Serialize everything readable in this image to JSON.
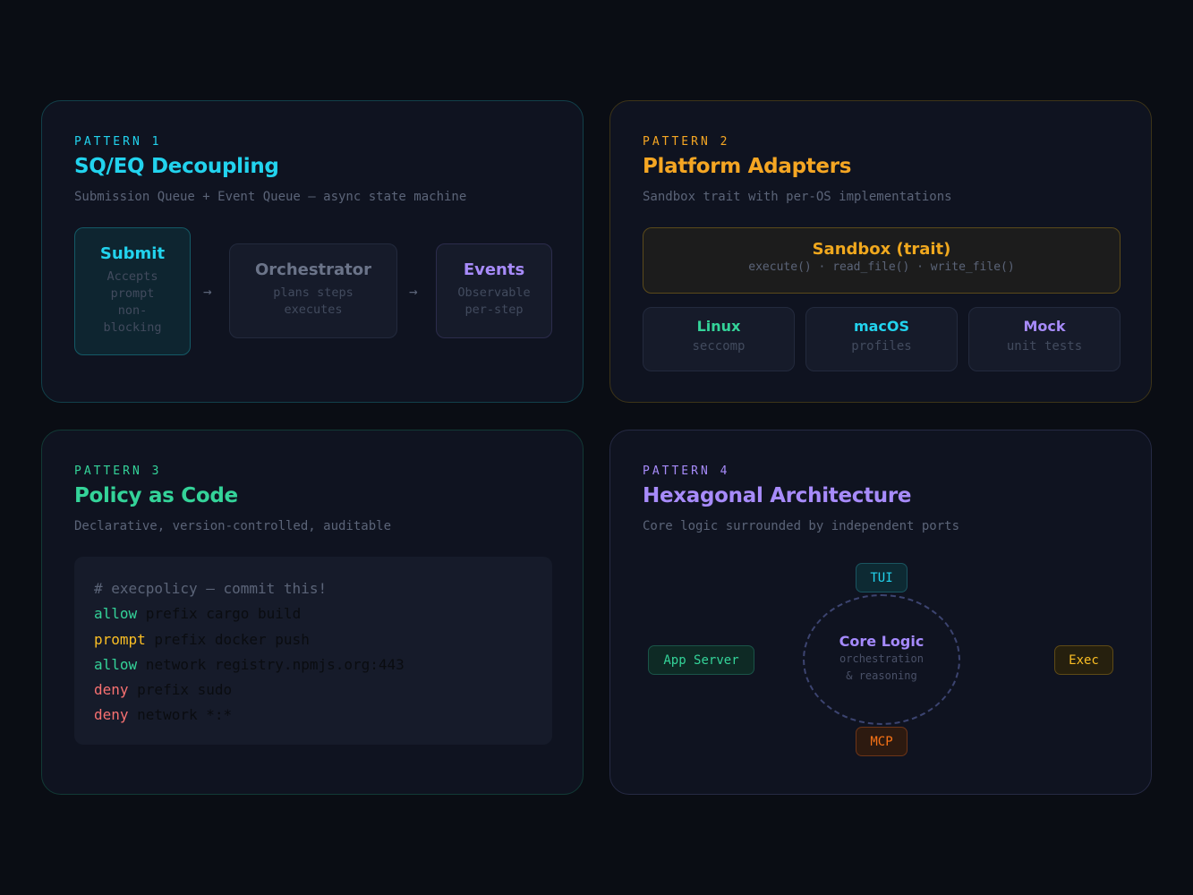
{
  "colors": {
    "cyan": "#22d3ee",
    "amber": "#f5a623",
    "green": "#34d399",
    "purple": "#a78bfa",
    "red": "#f87171",
    "orange": "#f97316"
  },
  "pattern1": {
    "eyebrow": "PATTERN 1",
    "title": "SQ/EQ Decoupling",
    "subtitle": "Submission Queue + Event Queue — async state machine",
    "arrow": "→",
    "submit": {
      "title": "Submit",
      "lines": [
        "Accepts",
        "prompt",
        "non-",
        "blocking"
      ]
    },
    "orchestrator": {
      "title": "Orchestrator",
      "lines": [
        "plans steps",
        "executes"
      ]
    },
    "events": {
      "title": "Events",
      "lines": [
        "Observable",
        "per-step"
      ]
    }
  },
  "pattern2": {
    "eyebrow": "PATTERN 2",
    "title": "Platform Adapters",
    "subtitle": "Sandbox trait with per-OS implementations",
    "trait": {
      "title": "Sandbox (trait)",
      "methods": "execute() · read_file() · write_file()"
    },
    "impls": [
      {
        "title": "Linux",
        "desc": "seccomp"
      },
      {
        "title": "macOS",
        "desc": "profiles"
      },
      {
        "title": "Mock",
        "desc": "unit tests"
      }
    ]
  },
  "pattern3": {
    "eyebrow": "PATTERN 3",
    "title": "Policy as Code",
    "subtitle": "Declarative, version-controlled, auditable",
    "comment": "# execpolicy — commit this!",
    "rules": [
      {
        "action": "allow",
        "rest": " prefix cargo build"
      },
      {
        "action": "prompt",
        "rest": " prefix docker push"
      },
      {
        "action": "allow",
        "rest": " network registry.npmjs.org:443"
      },
      {
        "action": "deny",
        "rest": " prefix sudo"
      },
      {
        "action": "deny",
        "rest": " network *:*"
      }
    ]
  },
  "pattern4": {
    "eyebrow": "PATTERN 4",
    "title": "Hexagonal Architecture",
    "subtitle": "Core logic surrounded by independent ports",
    "core": {
      "title": "Core Logic",
      "line1": "orchestration",
      "line2": "& reasoning"
    },
    "ports": {
      "top": "TUI",
      "bottom": "MCP",
      "left": "App Server",
      "right": "Exec"
    }
  }
}
